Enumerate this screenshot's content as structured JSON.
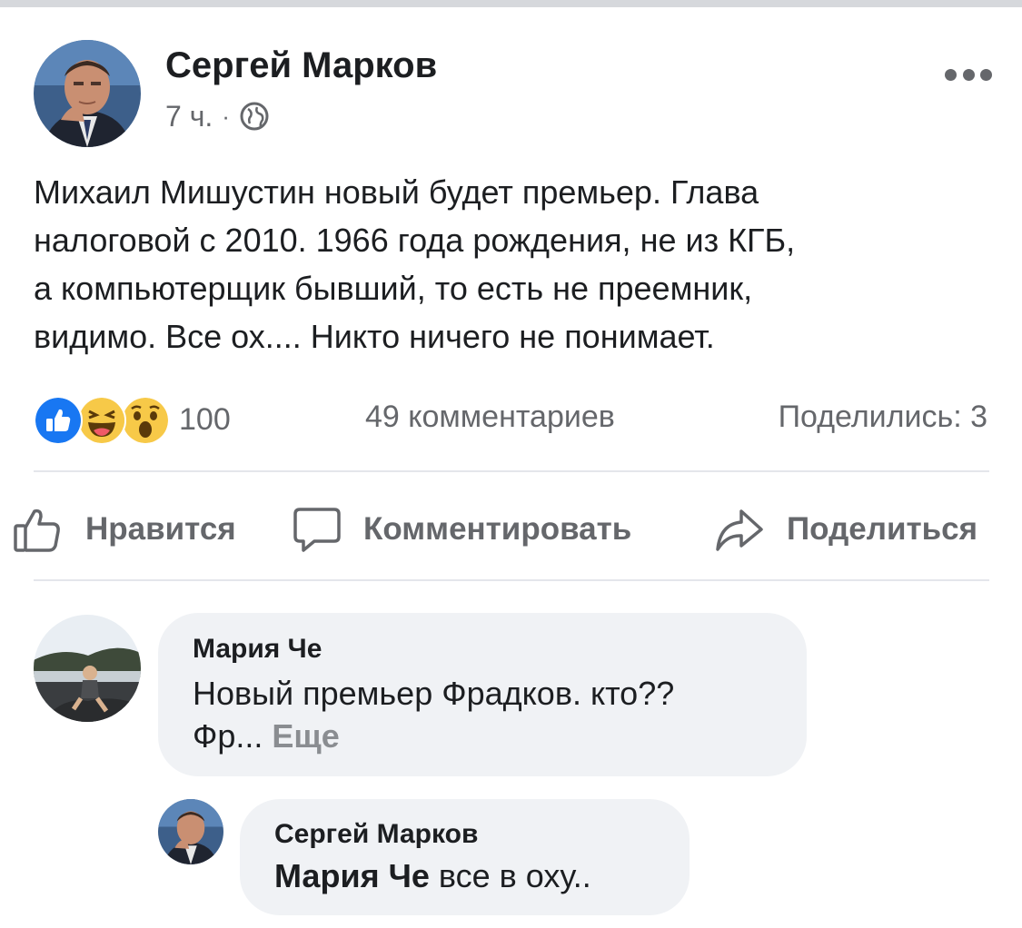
{
  "post": {
    "author": "Сергей Марков",
    "time": "7 ч.",
    "separator": "·",
    "privacy_icon": "globe-icon",
    "more_icon": "more-options-icon",
    "text_lines": [
      "Михаил Мишустин новый будет премьер. Глава",
      "налоговой с 2010. 1966 года рождения, не из КГБ,",
      "а компьютерщик бывший, то есть не преемник,",
      "видимо. Все ох.... Никто ничего не понимает."
    ]
  },
  "stats": {
    "reaction_icons": [
      "like-reaction-icon",
      "haha-reaction-icon",
      "wow-reaction-icon"
    ],
    "reactions_count": "100",
    "comments": "49 комментариев",
    "shares": "Поделились: 3"
  },
  "actions": {
    "like": "Нравится",
    "comment": "Комментировать",
    "share": "Поделиться"
  },
  "comments": [
    {
      "author": "Мария Че",
      "text_line1": "Новый премьер Фрадков. кто??",
      "text_line2": "Фр...",
      "more": "Еще"
    },
    {
      "author": "Сергей Марков",
      "mention": "Мария Че",
      "text": "все в оху.."
    }
  ],
  "colors": {
    "text": "#1c1e21",
    "secondary": "#65676b",
    "bubble": "#f0f2f5",
    "like_blue": "#1877f2",
    "reaction_yellow": "#f7c948"
  }
}
